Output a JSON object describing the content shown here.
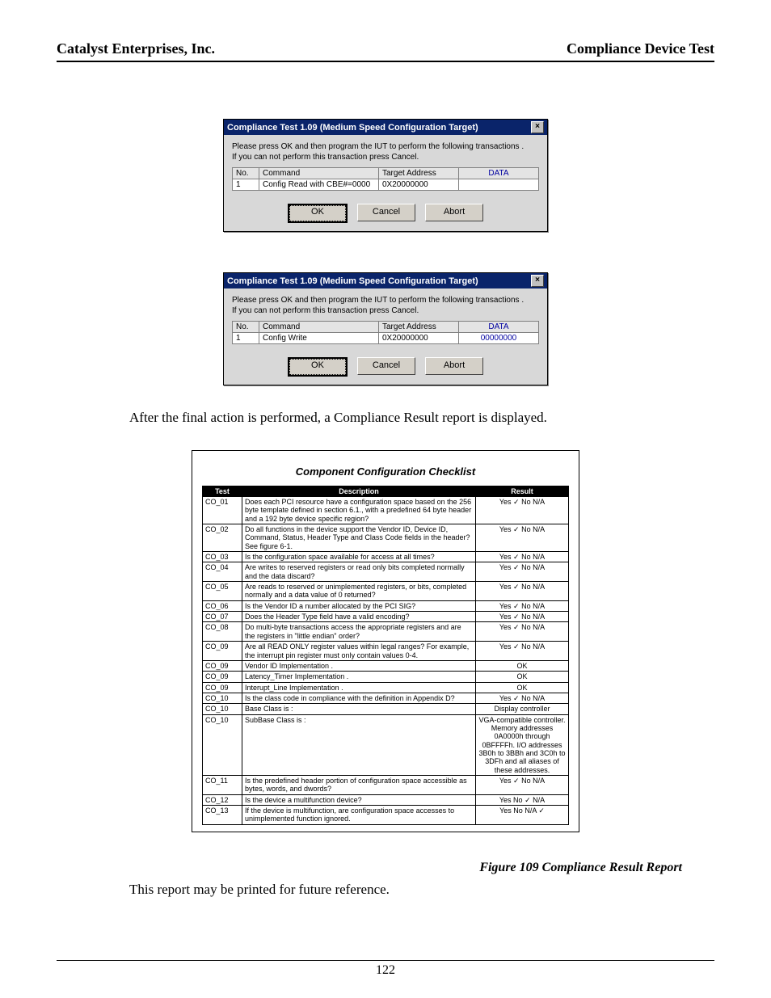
{
  "header": {
    "left": "Catalyst Enterprises, Inc.",
    "right": "Compliance Device Test"
  },
  "dialog1": {
    "title": "Compliance Test 1.09 (Medium Speed Configuration Target)",
    "line1": "Please press OK and then program the IUT to perform the following transactions .",
    "line2": "If you can not perform this transaction press Cancel.",
    "cols": {
      "no": "No.",
      "cmd": "Command",
      "addr": "Target Address",
      "data": "DATA"
    },
    "row": {
      "no": "1",
      "cmd": "Config Read with CBE#=0000",
      "addr": "0X20000000",
      "data": ""
    },
    "btn_ok": "OK",
    "btn_cancel": "Cancel",
    "btn_abort": "Abort"
  },
  "dialog2": {
    "title": "Compliance Test 1.09 (Medium Speed Configuration Target)",
    "line1": "Please press OK and then program the IUT to perform the following transactions .",
    "line2": "If you can not perform this transaction press Cancel.",
    "cols": {
      "no": "No.",
      "cmd": "Command",
      "addr": "Target Address",
      "data": "DATA"
    },
    "row": {
      "no": "1",
      "cmd": "Config Write",
      "addr": "0X20000000",
      "data": "00000000"
    },
    "btn_ok": "OK",
    "btn_cancel": "Cancel",
    "btn_abort": "Abort"
  },
  "body": {
    "after": "After the final action is performed, a Compliance Result report is displayed.",
    "printed": "This report may be printed for future reference."
  },
  "checklist": {
    "title": "Component Configuration Checklist",
    "cols": {
      "test": "Test",
      "desc": "Description",
      "result": "Result"
    },
    "rows": [
      {
        "t": "CO_01",
        "d": "Does each PCI resource have a configuration space based on the 256 byte template defined in section 6.1., with a predefined 64 byte header and a 192 byte device specific region?",
        "r": "Yes ✓  No      N/A"
      },
      {
        "t": "CO_02",
        "d": "Do all functions in the device support the Vendor ID, Device ID, Command, Status, Header Type and Class Code fields in the header? See figure 6-1.",
        "r": "Yes ✓  No      N/A"
      },
      {
        "t": "CO_03",
        "d": "Is the configuration space available for access at all times?",
        "r": "Yes ✓  No      N/A"
      },
      {
        "t": "CO_04",
        "d": "Are writes to reserved registers or read only bits completed normally and the data discard?",
        "r": "Yes ✓  No      N/A"
      },
      {
        "t": "CO_05",
        "d": "Are reads to reserved or unimplemented registers, or bits, completed normally and a data value of 0 returned?",
        "r": "Yes ✓  No      N/A"
      },
      {
        "t": "CO_06",
        "d": "Is the Vendor ID a number allocated by the PCI SIG?",
        "r": "Yes ✓  No      N/A"
      },
      {
        "t": "CO_07",
        "d": "Does the Header Type field have a valid encoding?",
        "r": "Yes ✓  No      N/A"
      },
      {
        "t": "CO_08",
        "d": "Do multi-byte transactions access the appropriate registers and are the registers in \"little endian\" order?",
        "r": "Yes ✓  No      N/A"
      },
      {
        "t": "CO_09",
        "d": "Are all READ ONLY register values within legal ranges? For example, the interrupt pin register must only contain values 0-4.",
        "r": "Yes ✓  No      N/A"
      },
      {
        "t": "CO_09",
        "d": "Vendor ID Implementation .",
        "r": "OK"
      },
      {
        "t": "CO_09",
        "d": "Latency_Timer Implementation .",
        "r": "OK"
      },
      {
        "t": "CO_09",
        "d": "Interupt_Line Implementation .",
        "r": "OK"
      },
      {
        "t": "CO_10",
        "d": "Is the class code in compliance with the definition in Appendix D?",
        "r": "Yes ✓  No      N/A"
      },
      {
        "t": "CO_10",
        "d": "Base Class is :",
        "r": "Display controller"
      },
      {
        "t": "CO_10",
        "d": "SubBase Class is :",
        "r": "VGA-compatible controller. Memory addresses 0A0000h through 0BFFFFh. I/O addresses 3B0h to 3BBh and 3C0h to 3DFh and all aliases of these addresses."
      },
      {
        "t": "CO_11",
        "d": "Is the predefined header portion of configuration space accessible as bytes, words, and dwords?",
        "r": "Yes ✓  No      N/A"
      },
      {
        "t": "CO_12",
        "d": "Is the device a multifunction device?",
        "r": "Yes   No ✓   N/A"
      },
      {
        "t": "CO_13",
        "d": "If the device is multifunction, are configuration space accesses to unimplemented function ignored.",
        "r": "Yes   No    N/A ✓"
      }
    ]
  },
  "caption": "Figure  109  Compliance Result Report",
  "page_number": "122"
}
